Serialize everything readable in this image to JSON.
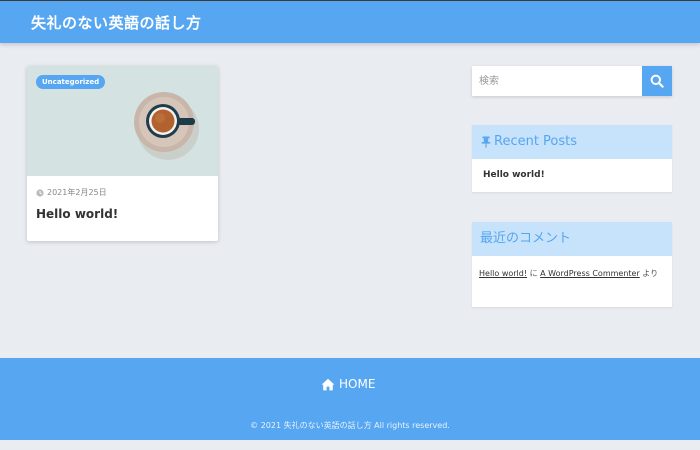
{
  "site": {
    "title": "失礼のない英語の話し方"
  },
  "post": {
    "category": "Uncategorized",
    "date": "2021年2月25日",
    "title": "Hello world!",
    "thumbnail_icon": "coffee-cup-image"
  },
  "search": {
    "placeholder": "検索",
    "value": "",
    "button_icon": "search-icon"
  },
  "recent_posts": {
    "heading": "Recent Posts",
    "heading_icon": "pin-icon",
    "items": [
      {
        "label": "Hello world!"
      }
    ]
  },
  "recent_comments": {
    "heading": "最近のコメント",
    "items": [
      {
        "post_link": "Hello world!",
        "connector": "に",
        "author_link": "A WordPress Commenter",
        "suffix": "より"
      }
    ]
  },
  "footer": {
    "home_label": "HOME",
    "home_icon": "home-icon",
    "copyright": "© 2021 失礼のない英語の話し方 All rights reserved."
  },
  "colors": {
    "accent": "#56a6f1",
    "widget_head_bg": "#c7e2fb",
    "page_bg": "#e9ecf1"
  }
}
